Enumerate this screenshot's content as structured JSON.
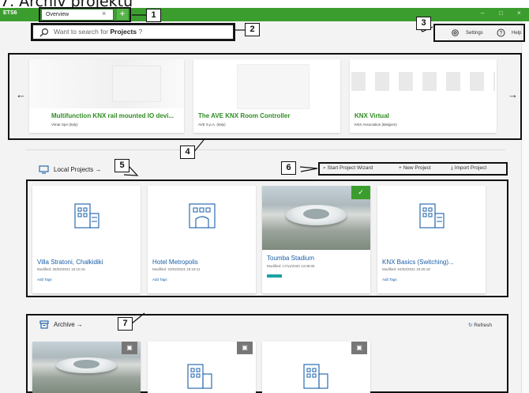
{
  "caption": "7. Archiv projektu",
  "titlebar": {
    "app": "ETS6",
    "tab_label": "Overview",
    "tab_close": "×",
    "new_tab": "+",
    "minimize": "–",
    "maximize": "□",
    "close": "×"
  },
  "search": {
    "prefix": "Want to search for",
    "term": "Projects",
    "suffix": "?"
  },
  "header": {
    "settings": "Settings",
    "help": "Help"
  },
  "featured": [
    {
      "title": "Multifunction KNX rail mounted IO devi...",
      "subtitle": "Vimar SpA (Italy)"
    },
    {
      "title": "The AVE KNX Room Controller",
      "subtitle": "AVE S.p.A. (Italy)"
    },
    {
      "title": "KNX Virtual",
      "subtitle": "KNX Association (Belgium)"
    }
  ],
  "nav": {
    "prev": "←",
    "next": "→"
  },
  "local": {
    "title": "Local Projects",
    "arrow": "→",
    "start_wizard": "Start Project Wizard",
    "new_project": "New Project",
    "import_project": "Import Project"
  },
  "projects": [
    {
      "name": "Villa Stratoni, Chalkidiki",
      "modified": "Modified: 25/02/2021 15:10:16",
      "tags": "Add Tags"
    },
    {
      "name": "Hotel Metropolis",
      "modified": "Modified: 23/02/2021 15:18:11",
      "tags": "Add Tags"
    },
    {
      "name": "Toumba Stadium",
      "modified": "Modified: 17/11/2020 13:08:05",
      "tags": ""
    },
    {
      "name": "KNX Basics (Switching)...",
      "modified": "Modified: 04/02/2021 15:25:18",
      "tags": "Add Tags"
    }
  ],
  "archive": {
    "title": "Archive",
    "arrow": "→",
    "refresh": "Refresh"
  },
  "callouts": [
    "1",
    "2",
    "3",
    "4",
    "5",
    "6",
    "7"
  ],
  "colors": {
    "accent": "#3c9d2f",
    "link": "#1a5fa8",
    "featured_title": "#2e8d22"
  }
}
